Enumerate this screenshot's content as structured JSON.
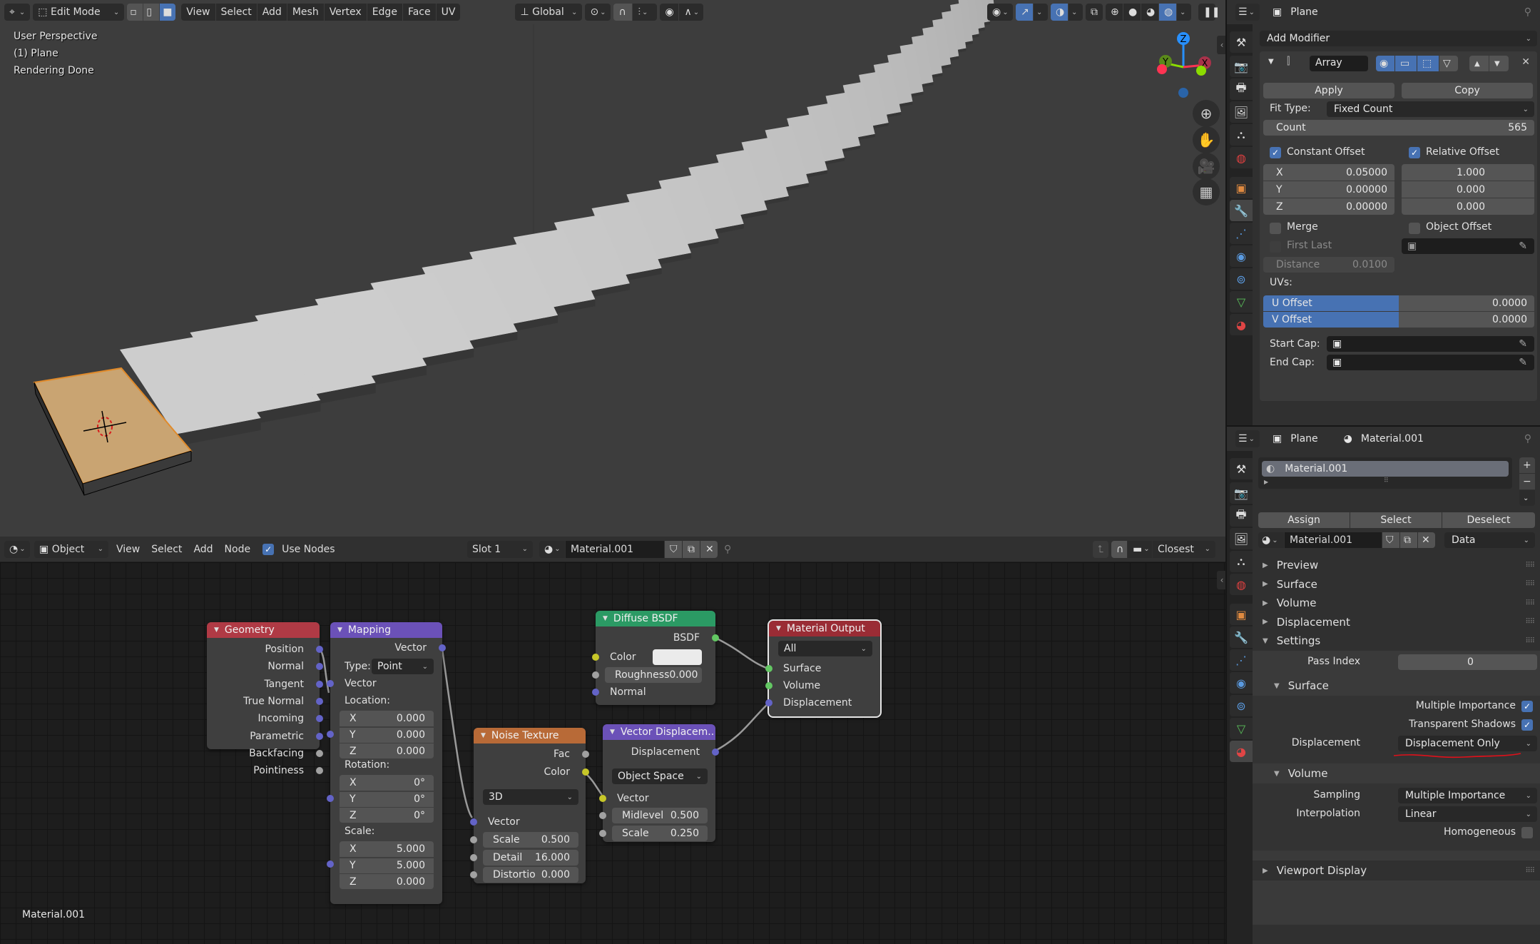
{
  "viewport": {
    "header": {
      "editor_type_icon": "3d-viewport-icon",
      "mode": "Edit Mode",
      "select_modes": [
        "vertex-select-icon",
        "edge-select-icon",
        "face-select-icon"
      ],
      "active_select_mode": "face",
      "menus": [
        "View",
        "Select",
        "Add",
        "Mesh",
        "Vertex",
        "Edge",
        "Face",
        "UV"
      ],
      "transform_orientation": "Global"
    },
    "overlay": {
      "line1": "User Perspective",
      "line2": "(1) Plane",
      "line3": "Rendering Done"
    },
    "gizmo": {
      "z": "Z",
      "y": "Y",
      "x": "X"
    },
    "shading_active": "rendered",
    "accent_colors": {
      "selected": "#4772b3",
      "selection_orange": "#e09a52",
      "axis_x": "#ff3352",
      "axis_y": "#8bdc00",
      "axis_z": "#2890ff"
    }
  },
  "node_editor": {
    "header": {
      "editor_type_icon": "shader-editor-icon",
      "object_type": "Object",
      "menus": [
        "View",
        "Select",
        "Add",
        "Node"
      ],
      "use_nodes_label": "Use Nodes",
      "use_nodes": true,
      "slot": "Slot 1",
      "material": "Material.001",
      "interpolation": "Closest"
    },
    "material_label": "Material.001",
    "nodes": {
      "geometry": {
        "title": "Geometry",
        "outputs": [
          "Position",
          "Normal",
          "Tangent",
          "True Normal",
          "Incoming",
          "Parametric",
          "Backfacing",
          "Pointiness"
        ]
      },
      "mapping": {
        "title": "Mapping",
        "output": "Vector",
        "type_label": "Type:",
        "type_value": "Point",
        "vector_label": "Vector",
        "location_label": "Location:",
        "location": [
          [
            "X",
            "0.000"
          ],
          [
            "Y",
            "0.000"
          ],
          [
            "Z",
            "0.000"
          ]
        ],
        "rotation_label": "Rotation:",
        "rotation": [
          [
            "X",
            "0°"
          ],
          [
            "Y",
            "0°"
          ],
          [
            "Z",
            "0°"
          ]
        ],
        "scale_label": "Scale:",
        "scale": [
          [
            "X",
            "5.000"
          ],
          [
            "Y",
            "5.000"
          ],
          [
            "Z",
            "0.000"
          ]
        ]
      },
      "noise": {
        "title": "Noise Texture",
        "outputs": [
          "Fac",
          "Color"
        ],
        "dimensions": "3D",
        "vector_label": "Vector",
        "fields": [
          [
            "Scale",
            "0.500"
          ],
          [
            "Detail",
            "16.000"
          ],
          [
            "Distortio",
            "0.000"
          ]
        ]
      },
      "diffuse": {
        "title": "Diffuse BSDF",
        "output": "BSDF",
        "color_label": "Color",
        "color_value": "#ebebeb",
        "roughness": [
          "Roughness",
          "0.000"
        ],
        "normal_label": "Normal"
      },
      "vector_displacement": {
        "title": "Vector Displacem..",
        "output": "Displacement",
        "space": "Object Space",
        "vector_label": "Vector",
        "fields": [
          [
            "Midlevel",
            "0.500"
          ],
          [
            "Scale",
            "0.250"
          ]
        ]
      },
      "material_output": {
        "title": "Material Output",
        "target": "All",
        "inputs": [
          "Surface",
          "Volume",
          "Displacement"
        ]
      }
    }
  },
  "properties_modifier": {
    "header": {
      "object_name": "Plane"
    },
    "add_modifier": "Add Modifier",
    "modifier": {
      "name": "Array",
      "apply": "Apply",
      "copy": "Copy",
      "fit_type_label": "Fit Type:",
      "fit_type": "Fixed Count",
      "count_label": "Count",
      "count": "565",
      "constant_offset_label": "Constant Offset",
      "constant_offset": true,
      "relative_offset_label": "Relative Offset",
      "relative_offset": true,
      "constant": [
        [
          "X",
          "0.05000"
        ],
        [
          "Y",
          "0.00000"
        ],
        [
          "Z",
          "0.00000"
        ]
      ],
      "relative": [
        "1.000",
        "0.000",
        "0.000"
      ],
      "merge_label": "Merge",
      "merge": false,
      "object_offset_label": "Object Offset",
      "object_offset": false,
      "first_last_label": "First Last",
      "distance_label": "Distance",
      "distance": "0.0100",
      "uvs_label": "UVs:",
      "u_offset_label": "U Offset",
      "u_offset": "0.0000",
      "v_offset_label": "V Offset",
      "v_offset": "0.0000",
      "start_cap_label": "Start Cap:",
      "end_cap_label": "End Cap:"
    }
  },
  "properties_material": {
    "header": {
      "object_name": "Plane",
      "material_name": "Material.001"
    },
    "slot_list": [
      "Material.001"
    ],
    "assign": "Assign",
    "select": "Select",
    "deselect": "Deselect",
    "material_name": "Material.001",
    "link": "Data",
    "panels": [
      "Preview",
      "Surface",
      "Volume",
      "Displacement"
    ],
    "settings": {
      "title": "Settings",
      "pass_index_label": "Pass Index",
      "pass_index": "0",
      "surface_title": "Surface",
      "multiple_importance_label": "Multiple Importance",
      "multiple_importance": true,
      "transparent_shadows_label": "Transparent Shadows",
      "transparent_shadows": true,
      "displacement_label": "Displacement",
      "displacement": "Displacement Only",
      "volume_title": "Volume",
      "sampling_label": "Sampling",
      "sampling": "Multiple Importance",
      "interpolation_label": "Interpolation",
      "interpolation": "Linear",
      "homogeneous_label": "Homogeneous",
      "homogeneous": false
    },
    "viewport_display": "Viewport Display",
    "annotation_color": "#e0101a"
  }
}
